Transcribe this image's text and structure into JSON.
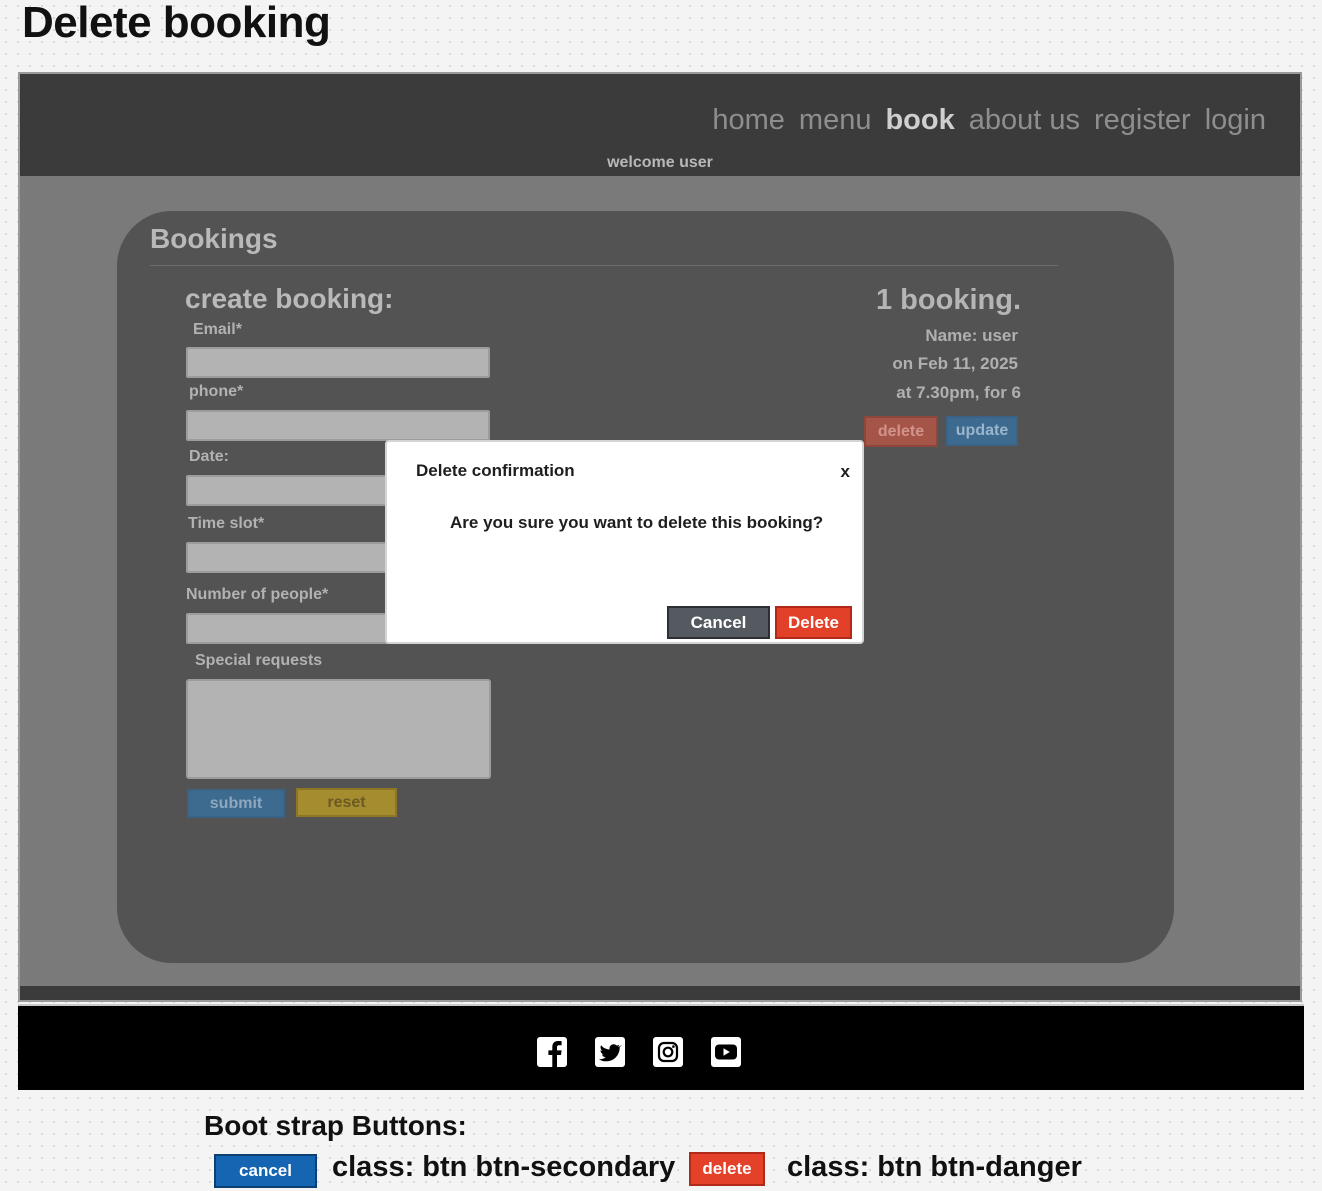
{
  "page_title": "Delete booking",
  "nav": {
    "items": [
      {
        "label": "home",
        "active": false
      },
      {
        "label": "menu",
        "active": false
      },
      {
        "label": "book",
        "active": true
      },
      {
        "label": "about us",
        "active": false
      },
      {
        "label": "register",
        "active": false
      },
      {
        "label": "login",
        "active": false
      }
    ],
    "welcome": "welcome user"
  },
  "card": {
    "title": "Bookings",
    "form": {
      "title": "create booking:",
      "fields": {
        "email": {
          "label": "Email*",
          "value": ""
        },
        "phone": {
          "label": "phone*",
          "value": ""
        },
        "date": {
          "label": "Date:",
          "value": ""
        },
        "time_slot": {
          "label": "Time slot*",
          "value": ""
        },
        "people": {
          "label": "Number of people*",
          "value": ""
        },
        "requests": {
          "label": "Special requests",
          "value": ""
        }
      },
      "submit_label": "submit",
      "reset_label": "reset"
    },
    "booking": {
      "count_text": "1 booking.",
      "name_line": "Name: user",
      "date_line": "on Feb 11, 2025",
      "time_line": "at 7.30pm, for 6",
      "delete_label": "delete",
      "update_label": "update"
    }
  },
  "modal": {
    "title": "Delete confirmation",
    "close_label": "x",
    "body": "Are you sure you want to delete this booking?",
    "cancel_label": "Cancel",
    "delete_label": "Delete"
  },
  "footer": {
    "icons": [
      "facebook-icon",
      "twitter-icon",
      "instagram-icon",
      "youtube-icon"
    ]
  },
  "legend": {
    "title": "Boot strap Buttons:",
    "cancel_sample": "cancel",
    "cancel_class": "class: btn btn-secondary",
    "delete_sample": "delete",
    "delete_class": "class: btn btn-danger"
  },
  "colors": {
    "secondary": "#555a61",
    "danger": "#e3402a",
    "primary_legend": "#1565b3"
  }
}
